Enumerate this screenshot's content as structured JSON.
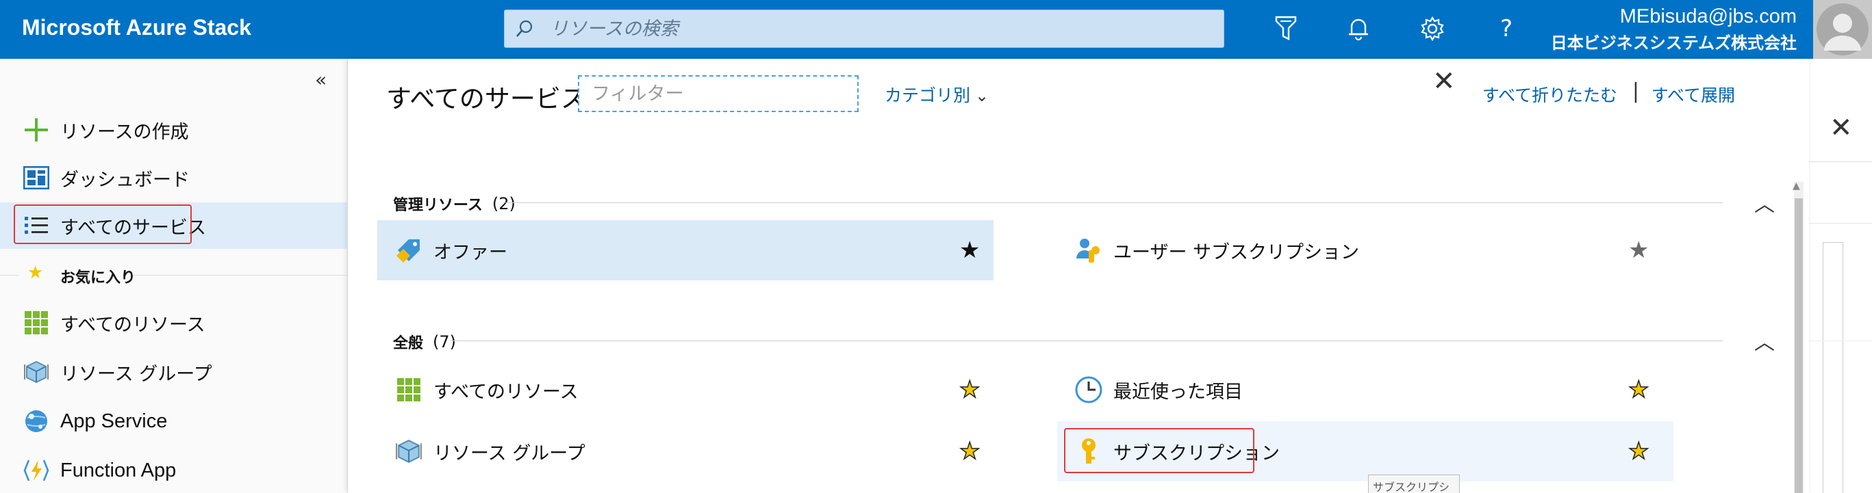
{
  "header": {
    "brand": "Microsoft Azure Stack",
    "search_placeholder": "リソースの検索",
    "user_email": "MEbisuda@jbs.com",
    "user_org": "日本ビジネスシステムズ株式会社",
    "icons": [
      "filter-icon",
      "bell-icon",
      "gear-icon",
      "help-icon"
    ]
  },
  "leftnav": {
    "collapse_glyph": "«",
    "items": [
      {
        "label": "リソースの作成",
        "icon": "plus-icon"
      },
      {
        "label": "ダッシュボード",
        "icon": "dashboard-icon"
      },
      {
        "label": "すべてのサービス",
        "icon": "list-icon"
      }
    ],
    "favorites_label": "お気に入り",
    "favorites": [
      {
        "label": "すべてのリソース",
        "icon": "grid-icon"
      },
      {
        "label": "リソース グループ",
        "icon": "cube-icon"
      },
      {
        "label": "App Service",
        "icon": "globe-icon"
      },
      {
        "label": "Function App",
        "icon": "lightning-icon"
      }
    ]
  },
  "panel": {
    "title": "すべてのサービス",
    "filter_placeholder": "フィルター",
    "category_label": "カテゴリ別",
    "collapse_all": "すべて折りたたむ",
    "separator": "|",
    "expand_all": "すべて展開",
    "sections": [
      {
        "name": "管理リソース",
        "count": "(2)",
        "items": [
          {
            "label": "オファー",
            "icon": "offer-icon",
            "star": "filled-black"
          },
          {
            "label": "ユーザー サブスクリプション",
            "icon": "user-subscription-icon",
            "star": "filled-gray"
          }
        ]
      },
      {
        "name": "全般",
        "count": "(7)",
        "items": [
          {
            "label": "すべてのリソース",
            "icon": "grid-icon",
            "star": "filled-gold"
          },
          {
            "label": "最近使った項目",
            "icon": "clock-icon",
            "star": "filled-gold"
          },
          {
            "label": "リソース グループ",
            "icon": "cube-icon",
            "star": "filled-gold"
          },
          {
            "label": "サブスクリプション",
            "icon": "key-icon",
            "star": "filled-gold"
          }
        ]
      }
    ],
    "tooltip": "サブスクリプション"
  },
  "colors": {
    "topbar": "#0072c6",
    "accent_link": "#0062ad",
    "highlight": "#e03a3a",
    "star_gold": "#f3c700"
  }
}
